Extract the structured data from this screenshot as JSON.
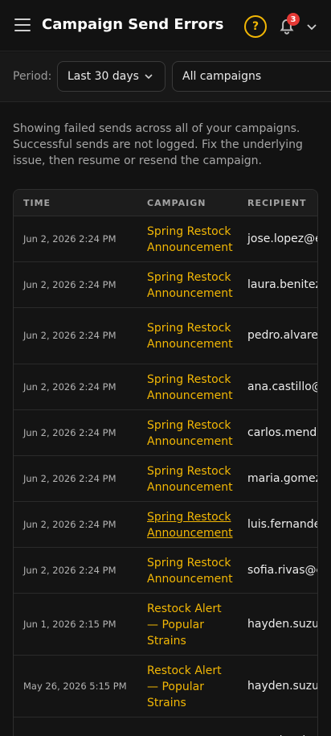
{
  "header": {
    "title": "Campaign Send Errors",
    "help_icon": "question-circle-icon",
    "notification_count": "3",
    "menu_icon": "hamburger-menu-icon",
    "chevron_icon": "chevron-down-icon",
    "accent_color": "#f2b705",
    "badge_color": "#e53935"
  },
  "filters": {
    "period_label": "Period:",
    "period_value": "Last 30 days",
    "campaign_value": "All campaigns"
  },
  "info_text": "Showing failed sends across all of your campaigns. Successful sends are not logged. Fix the underlying issue, then resume or resend the campaign.",
  "table": {
    "columns": [
      "TIME",
      "CAMPAIGN",
      "RECIPIENT"
    ],
    "rows": [
      {
        "time": "Jun 2, 2026 2:24 PM",
        "campaign": [
          "Spring Restock",
          "Announcement"
        ],
        "recipient": "jose.lopez@ex"
      },
      {
        "time": "Jun 2, 2026 2:24 PM",
        "campaign": [
          "Spring Restock",
          "Announcement"
        ],
        "recipient": "laura.benitez"
      },
      {
        "time": "Jun 2, 2026 2:24 PM",
        "campaign": [
          "Spring Restock",
          "Announcement"
        ],
        "recipient": "pedro.alvarez"
      },
      {
        "time": "Jun 2, 2026 2:24 PM",
        "campaign": [
          "Spring Restock",
          "Announcement"
        ],
        "recipient": "ana.castillo@"
      },
      {
        "time": "Jun 2, 2026 2:24 PM",
        "campaign": [
          "Spring Restock",
          "Announcement"
        ],
        "recipient": "carlos.mendo"
      },
      {
        "time": "Jun 2, 2026 2:24 PM",
        "campaign": [
          "Spring Restock",
          "Announcement"
        ],
        "recipient": "maria.gomez"
      },
      {
        "time": "Jun 2, 2026 2:24 PM",
        "campaign": [
          "Spring Restock",
          "Announcement"
        ],
        "recipient": "luis.fernande",
        "hovered": true
      },
      {
        "time": "Jun 2, 2026 2:24 PM",
        "campaign": [
          "Spring Restock",
          "Announcement"
        ],
        "recipient": "sofia.rivas@e"
      },
      {
        "time": "Jun 1, 2026 2:15 PM",
        "campaign": [
          "Restock Alert",
          "— Popular",
          "Strains"
        ],
        "recipient": "hayden.suzuk"
      },
      {
        "time": "May 26, 2026 5:15 PM",
        "campaign": [
          "Restock Alert",
          "— Popular",
          "Strains"
        ],
        "recipient": "hayden.suzuk"
      },
      {
        "time": "",
        "campaign": [
          "Weekend Drop"
        ],
        "recipient": "taus.density"
      }
    ]
  }
}
